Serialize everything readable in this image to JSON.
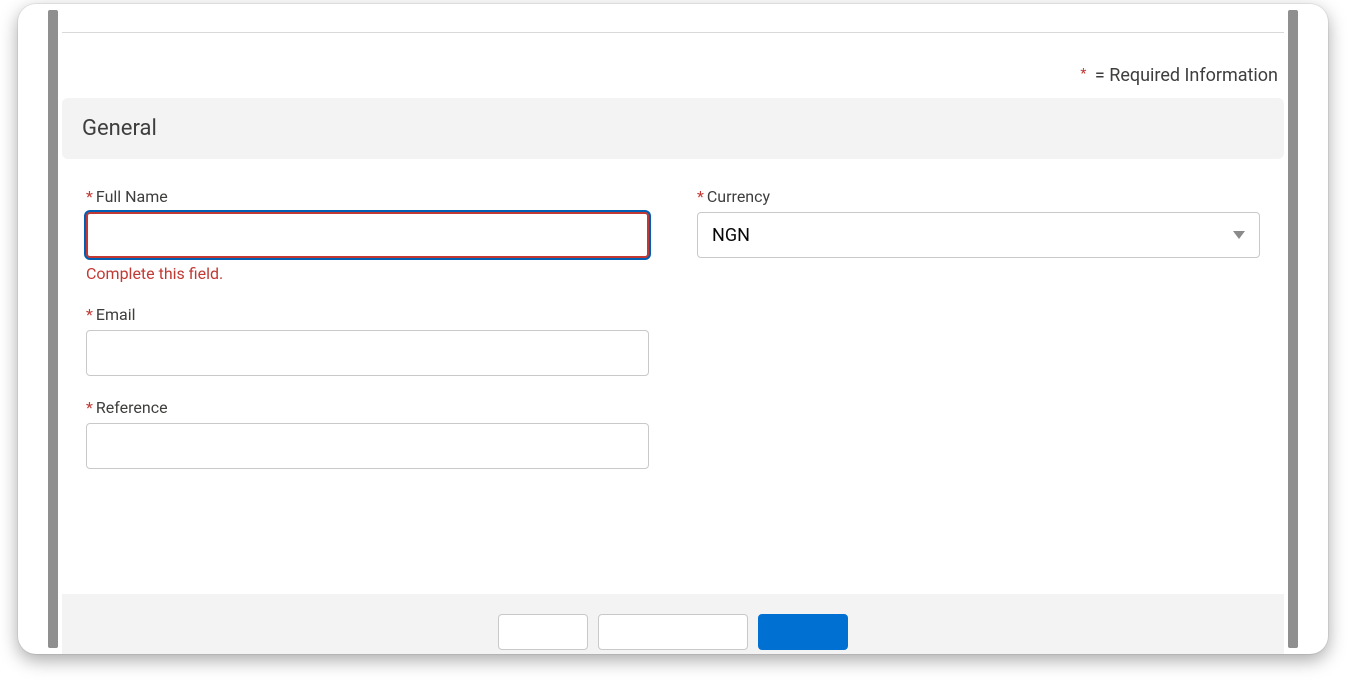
{
  "meta": {
    "required_note_prefix": "*",
    "required_note_text": " = Required Information"
  },
  "section": {
    "title": "General"
  },
  "fields": {
    "full_name": {
      "label": "Full Name",
      "value": "",
      "error": "Complete this field."
    },
    "currency": {
      "label": "Currency",
      "selected": "NGN"
    },
    "email": {
      "label": "Email",
      "value": ""
    },
    "reference": {
      "label": "Reference",
      "value": ""
    }
  }
}
